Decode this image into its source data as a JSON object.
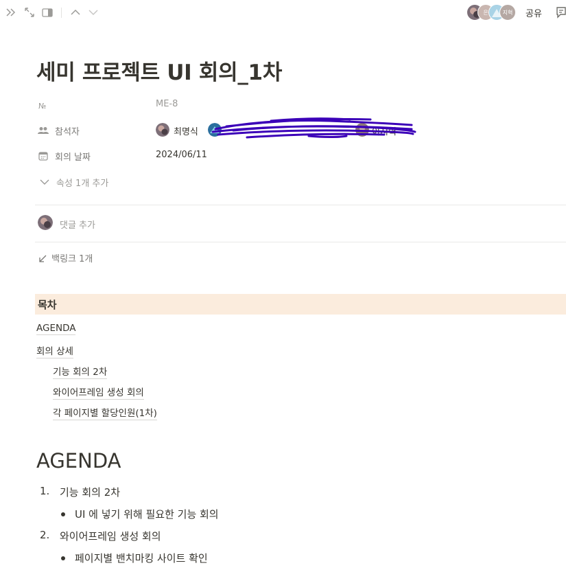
{
  "topbar": {
    "icons": [
      "double-chevron-right-icon",
      "expand-icon",
      "sidebar-peek-icon",
      "chevron-up-icon",
      "chevron-down-icon"
    ],
    "avatars": [
      {
        "initials": "",
        "color": "#8a7f86"
      },
      {
        "initials": "은",
        "color": "#c9b6b0"
      },
      {
        "initials": "",
        "color": "#9ec7db"
      },
      {
        "initials": "지혁",
        "color": "#b5a8a3"
      }
    ],
    "share_label": "공유"
  },
  "page": {
    "title": "세미 프로젝트 UI 회의_1차",
    "properties": {
      "number": {
        "label": "№",
        "value": "ME-8"
      },
      "participants": {
        "label": "참석자",
        "first_name": "최명식",
        "last_name": "이지혁"
      },
      "meeting_date": {
        "label": "회의 날짜",
        "value": "2024/06/11"
      },
      "add_property": "속성 1개 추가"
    },
    "comment_placeholder": "댓글 추가",
    "backlinks": "백링크 1개"
  },
  "toc": {
    "heading": "목차",
    "items": [
      "AGENDA",
      "회의 상세",
      "기능 회의 2차",
      "와이어프레임 생성 회의",
      "각 페이지별 할당인원(1차)"
    ]
  },
  "agenda": {
    "heading": "AGENDA",
    "items": [
      {
        "num": "1.",
        "text": "기능 회의 2차",
        "sub": "UI 에 넣기 위해 필요한 기능 회의"
      },
      {
        "num": "2.",
        "text": "와이어프레임 생성 회의",
        "sub": "페이지별 밴치마킹 사이트 확인"
      }
    ]
  },
  "colors": {
    "toc_highlight": "#fbecdd",
    "text": "#37352f",
    "muted": "#9b9a97",
    "scribble": "#3b00b8"
  }
}
